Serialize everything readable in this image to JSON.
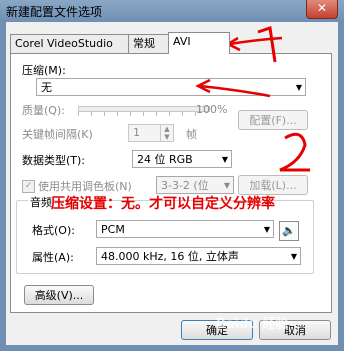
{
  "window": {
    "title": "新建配置文件选项",
    "close_glyph": "✕"
  },
  "tabs": [
    {
      "label": "Corel VideoStudio"
    },
    {
      "label": "常规"
    },
    {
      "label": "AVI"
    }
  ],
  "compression": {
    "label": "压缩(M):",
    "value": "无"
  },
  "quality": {
    "label": "质量(Q):",
    "value": "100%"
  },
  "configure_button": "配置(F)...",
  "keyframe": {
    "label": "关键帧间隔(K)",
    "value": "1",
    "unit": "帧"
  },
  "data_type": {
    "label": "数据类型(T):",
    "value": "24 位 RGB"
  },
  "palette": {
    "label": "使用共用调色板(N)",
    "value": "3-3-2 (位",
    "load_button": "加载(L)..."
  },
  "audio": {
    "group_title": "音频",
    "format_label": "格式(O):",
    "format_value": "PCM",
    "attributes_label": "属性(A):",
    "attributes_value": "48.000 kHz, 16 位, 立体声"
  },
  "advanced_button": "高级(V)...",
  "ok_button": "确定",
  "cancel_button": "取消",
  "annotations": {
    "note": "压缩设置：无。才可以自定义分辨率",
    "color": "#e60000"
  },
  "watermark": "Baidu 经验"
}
